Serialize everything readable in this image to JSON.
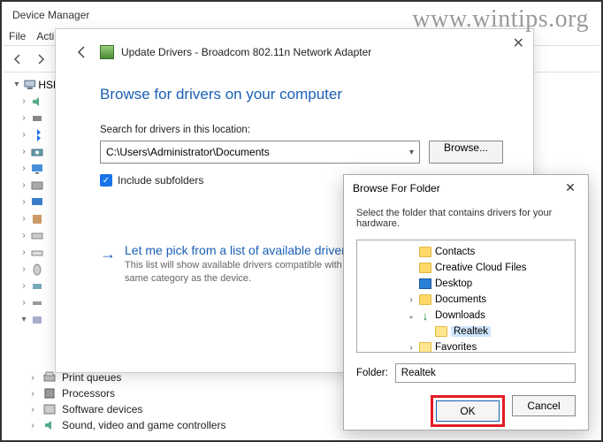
{
  "watermark": "www.wintips.org",
  "deviceManager": {
    "title": "Device Manager",
    "menu": {
      "file": "File",
      "action": "Acti"
    },
    "root": "HSE"
  },
  "bottomCategories": {
    "printQueues": "Print queues",
    "processors": "Processors",
    "softwareDevices": "Software devices",
    "soundControllers": "Sound, video and game controllers"
  },
  "wizard": {
    "title": "Update Drivers - Broadcom 802.11n Network Adapter",
    "heading": "Browse for drivers on your computer",
    "searchLabel": "Search for drivers in this location:",
    "path": "C:\\Users\\Administrator\\Documents",
    "browseBtn": "Browse...",
    "includeSubfolders": "Include subfolders",
    "pickTitle": "Let me pick from a list of available drivers o",
    "pickSub": "This list will show available drivers compatible with the de\nsame category as the device."
  },
  "bff": {
    "title": "Browse For Folder",
    "instruction": "Select the folder that contains drivers for your hardware.",
    "items": {
      "contacts": "Contacts",
      "creativeCloud": "Creative Cloud Files",
      "desktop": "Desktop",
      "documents": "Documents",
      "downloads": "Downloads",
      "realtek": "Realtek",
      "favorites": "Favorites"
    },
    "folderLabel": "Folder:",
    "folderValue": "Realtek",
    "ok": "OK",
    "cancel": "Cancel"
  }
}
